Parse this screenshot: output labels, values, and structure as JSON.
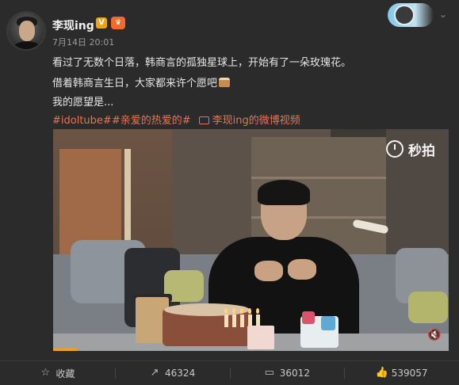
{
  "post": {
    "username": "李现ing",
    "verified_badge": "V",
    "member_badge": "♛",
    "timestamp": "7月14日 20:01",
    "line1": "看过了无数个日落，韩商言的孤独星球上，开始有了一朵玫瑰花。",
    "line2": "借着韩商言生日，大家都来许个愿吧",
    "line3": "我的愿望是...",
    "hashtag1": "#idoltube#",
    "hashtag2": "#亲爱的热爱的#",
    "video_link": "李现ing的微博视频"
  },
  "video": {
    "watermark": "秒拍",
    "mute_icon": "speaker-muted-icon",
    "progress_fraction": 0.06
  },
  "actions": {
    "favorite_label": "收藏",
    "repost_count": "46324",
    "comment_count": "36012",
    "like_count": "539057"
  },
  "colors": {
    "background": "#2b2b2b",
    "link_orange": "#eb7350",
    "text": "#e6e6e6",
    "muted": "#9a9a9a",
    "verified_badge": "#f3a312"
  }
}
